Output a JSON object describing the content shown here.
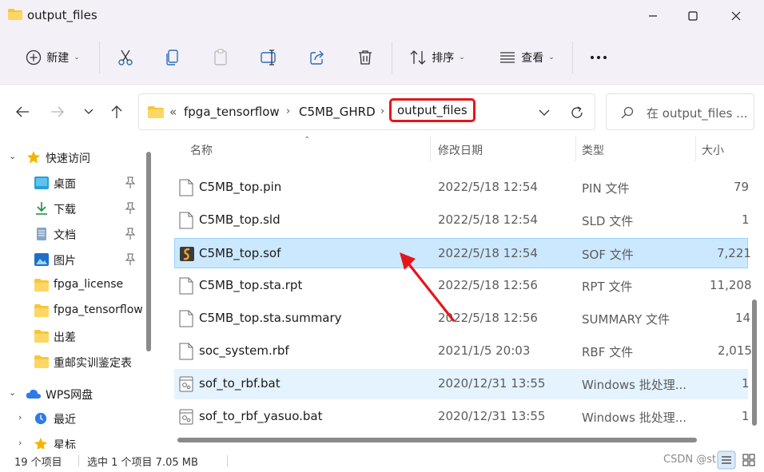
{
  "window": {
    "title": "output_files",
    "icons": {
      "title": "folder-icon",
      "minimize": "minimize-icon",
      "maximize": "maximize-icon",
      "close": "close-icon"
    }
  },
  "toolbar": {
    "new_label": "新建",
    "sort_label": "排序",
    "view_label": "查看",
    "icons": [
      "plus-circle-icon",
      "cut-icon",
      "copy-icon",
      "paste-icon",
      "rename-icon",
      "share-icon",
      "delete-icon",
      "sort-icon",
      "view-icon",
      "more-icon"
    ]
  },
  "address": {
    "overflow": "«",
    "crumbs": [
      "fpga_tensorflow",
      "C5MB_GHRD"
    ],
    "current": "output_files",
    "search_placeholder": "在 output_files ..."
  },
  "nav": {
    "quick_access": "快速访问",
    "items": [
      {
        "label": "桌面",
        "icon": "desktop-icon",
        "pinned": true
      },
      {
        "label": "下载",
        "icon": "download-icon",
        "pinned": true
      },
      {
        "label": "文档",
        "icon": "document-icon",
        "pinned": true
      },
      {
        "label": "图片",
        "icon": "picture-icon",
        "pinned": true
      },
      {
        "label": "fpga_license",
        "icon": "folder-icon",
        "pinned": false
      },
      {
        "label": "fpga_tensorflow",
        "icon": "folder-icon",
        "pinned": false
      },
      {
        "label": "出差",
        "icon": "folder-icon",
        "pinned": false
      },
      {
        "label": "重邮实训鉴定表",
        "icon": "folder-icon",
        "pinned": false
      }
    ],
    "wps_label": "WPS网盘",
    "recent_label": "最近",
    "starred_label": "星标"
  },
  "columns": {
    "name": "名称",
    "modified": "修改日期",
    "type": "类型",
    "size": "大小"
  },
  "files": [
    {
      "name": "C5MB_top.pin",
      "modified": "2022/5/18 12:54",
      "type": "PIN 文件",
      "size": "79",
      "icon": "file-icon"
    },
    {
      "name": "C5MB_top.sld",
      "modified": "2022/5/18 12:54",
      "type": "SLD 文件",
      "size": "1",
      "icon": "file-icon"
    },
    {
      "name": "C5MB_top.sof",
      "modified": "2022/5/18 12:54",
      "type": "SOF 文件",
      "size": "7,221",
      "icon": "sof-file-icon"
    },
    {
      "name": "C5MB_top.sta.rpt",
      "modified": "2022/5/18 12:56",
      "type": "RPT 文件",
      "size": "11,208",
      "icon": "file-icon"
    },
    {
      "name": "C5MB_top.sta.summary",
      "modified": "2022/5/18 12:56",
      "type": "SUMMARY 文件",
      "size": "14",
      "icon": "file-icon"
    },
    {
      "name": "soc_system.rbf",
      "modified": "2021/1/5 20:03",
      "type": "RBF 文件",
      "size": "2,015",
      "icon": "file-icon"
    },
    {
      "name": "sof_to_rbf.bat",
      "modified": "2020/12/31 13:55",
      "type": "Windows 批处理...",
      "size": "1",
      "icon": "batch-file-icon"
    },
    {
      "name": "sof_to_rbf_yasuo.bat",
      "modified": "2020/12/31 13:55",
      "type": "Windows 批处理...",
      "size": "1",
      "icon": "batch-file-icon"
    }
  ],
  "status": {
    "count": "19 个项目",
    "selection": "选中 1 个项目  7.05 MB",
    "watermark": "CSDN @st1bk"
  },
  "colors": {
    "selection_bg": "#cce8ff",
    "hover_bg": "#e5f3ff",
    "annotation_red": "#e4161c",
    "titlebar_bg": "#f3f0f7"
  }
}
